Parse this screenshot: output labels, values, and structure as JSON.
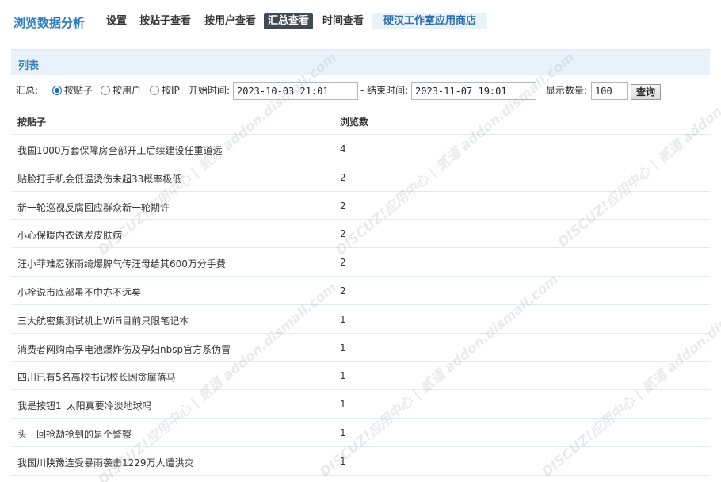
{
  "nav": {
    "brand": "浏览数据分析",
    "items": [
      {
        "label": "设置"
      },
      {
        "label": "按贴子查看"
      },
      {
        "label": "按用户查看"
      },
      {
        "label": "汇总查看"
      },
      {
        "label": "时间查看"
      }
    ],
    "store": "硬汉工作室应用商店",
    "active_index": 3
  },
  "panel": {
    "title": "列表"
  },
  "filter": {
    "summary_label": "汇总:",
    "options": [
      "按贴子",
      "按用户",
      "按IP"
    ],
    "selected": "按贴子",
    "start_label": "开始时间:",
    "start_value": "2023-10-03 21:01",
    "end_label": "- 结束时间:",
    "end_value": "2023-11-07 19:01",
    "count_label": "显示数量:",
    "count_value": "100",
    "query_button": "查询"
  },
  "table": {
    "headers": [
      "按贴子",
      "浏览数"
    ],
    "rows": [
      {
        "title": "我国1000万套保障房全部开工后续建设任重道远",
        "count": "4"
      },
      {
        "title": "贴脸打手机会低温烫伤未超33概率极低",
        "count": "2"
      },
      {
        "title": "新一轮巡视反腐回应群众新一轮期许",
        "count": "2"
      },
      {
        "title": "小心保暖内衣诱发皮肤病",
        "count": "2"
      },
      {
        "title": "汪小菲难忍张雨绮爆脾气传汪母给其600万分手费",
        "count": "2"
      },
      {
        "title": "小栓说市底部虽不中亦不远矣",
        "count": "2"
      },
      {
        "title": "三大航密集测试机上WiFi目前只限笔记本",
        "count": "1"
      },
      {
        "title": "消费者网购南孚电池爆炸伤及孕妇nbsp官方系伪冒",
        "count": "1"
      },
      {
        "title": "四川已有5名高校书记校长因贪腐落马",
        "count": "1"
      },
      {
        "title": "我是按钮1_太阳真要冷淡地球吗",
        "count": "1"
      },
      {
        "title": "头一回抢劫抢到的是个警察",
        "count": "1"
      },
      {
        "title": "我国川陕豫连受暴雨袭击1229万人遭洪灾",
        "count": "1"
      }
    ]
  },
  "watermark": {
    "text": "DISCUZ!应用中心 | 贰道 addon.dismall.com"
  }
}
